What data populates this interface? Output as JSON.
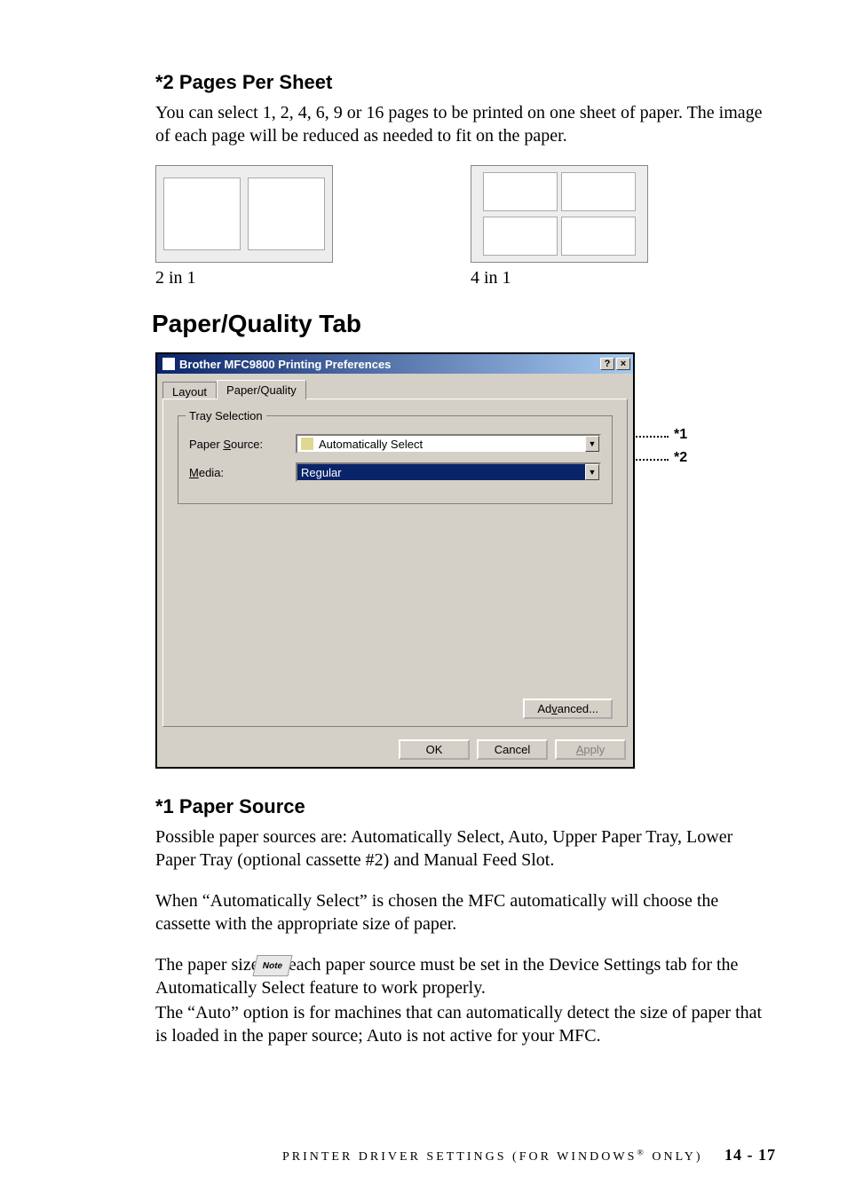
{
  "section1": {
    "heading": "*2 Pages Per Sheet",
    "para": "You can select 1, 2, 4, 6, 9 or 16 pages to be printed on one sheet of paper. The image of each page will be reduced as needed to fit on the paper.",
    "caption_left": "2 in 1",
    "caption_right": "4 in 1"
  },
  "section2": {
    "heading": "Paper/Quality Tab"
  },
  "dialog": {
    "title": "Brother MFC9800 Printing Preferences",
    "help_btn": "?",
    "close_btn": "×",
    "tabs": {
      "layout": "Layout",
      "paper_quality": "Paper/Quality"
    },
    "group_label": "Tray Selection",
    "paper_source": {
      "label_prefix": "Paper ",
      "label_u": "S",
      "label_suffix": "ource:",
      "value": "Automatically Select"
    },
    "media": {
      "label_u": "M",
      "label_suffix": "edia:",
      "value": "Regular"
    },
    "advanced_prefix": "Ad",
    "advanced_u": "v",
    "advanced_suffix": "anced...",
    "buttons": {
      "ok": "OK",
      "cancel": "Cancel",
      "apply_u": "A",
      "apply_suffix": "pply"
    }
  },
  "callouts": {
    "c1": "*1",
    "c2": "*2"
  },
  "section3": {
    "heading": "*1 Paper Source",
    "para1": "Possible paper sources are: Automatically Select, Auto, Upper Paper Tray, Lower Paper Tray (optional cassette #2) and Manual Feed Slot.",
    "para2": "When “Automatically Select” is chosen the MFC automatically will choose the cassette with the appropriate size of paper.",
    "note_label": "Note",
    "para3a": "The paper size for each paper source must be set in the Device Settings tab for the Automatically Select feature to work properly.",
    "para3b": "The “Auto” option is for machines that can automatically detect the size of paper that is loaded in the paper source; Auto is not active for your MFC."
  },
  "footer": {
    "text_a": "PRINTER DRIVER SETTINGS (FOR WINDOWS",
    "text_b": " ONLY)",
    "page": "14 - 17"
  }
}
